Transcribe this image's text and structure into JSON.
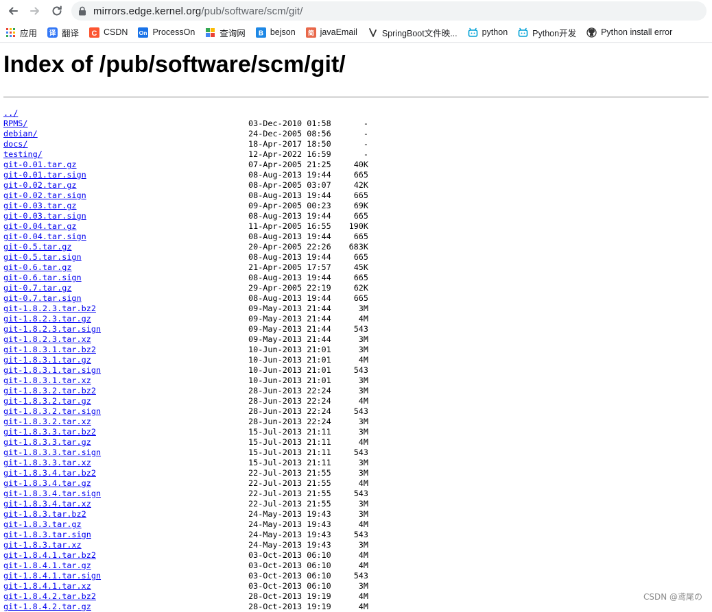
{
  "browser": {
    "url_host": "mirrors.edge.kernel.org",
    "url_path": "/pub/software/scm/git/",
    "bookmarks": [
      {
        "label": "应用",
        "icon": "apps-grid-icon",
        "color": "#ea4335"
      },
      {
        "label": "翻译",
        "icon": "translate-icon",
        "color": "#3478f6"
      },
      {
        "label": "CSDN",
        "icon": "csdn-icon",
        "color": "#fc5531"
      },
      {
        "label": "ProcessOn",
        "icon": "processon-icon",
        "color": "#1a73e8"
      },
      {
        "label": "查询网",
        "icon": "query-site-icon",
        "color": "#34a853"
      },
      {
        "label": "bejson",
        "icon": "bejson-icon",
        "color": "#1e88e5"
      },
      {
        "label": "javaEmail",
        "icon": "javaemail-icon",
        "color": "#e8684a"
      },
      {
        "label": "SpringBoot文件映...",
        "icon": "springboot-icon",
        "color": "#333333"
      },
      {
        "label": "python",
        "icon": "python-bot-icon",
        "color": "#00a1d6"
      },
      {
        "label": "Python开发",
        "icon": "python-dev-bot-icon",
        "color": "#00a1d6"
      },
      {
        "label": "Python install error",
        "icon": "github-icon",
        "color": "#333333"
      }
    ]
  },
  "page": {
    "title": "Index of /pub/software/scm/git/",
    "entries": [
      {
        "name": "../",
        "date": "",
        "size": ""
      },
      {
        "name": "RPMS/",
        "date": "03-Dec-2010 01:58",
        "size": "-"
      },
      {
        "name": "debian/",
        "date": "24-Dec-2005 08:56",
        "size": "-"
      },
      {
        "name": "docs/",
        "date": "18-Apr-2017 18:50",
        "size": "-"
      },
      {
        "name": "testing/",
        "date": "12-Apr-2022 16:59",
        "size": "-"
      },
      {
        "name": "git-0.01.tar.gz",
        "date": "07-Apr-2005 21:25",
        "size": "40K"
      },
      {
        "name": "git-0.01.tar.sign",
        "date": "08-Aug-2013 19:44",
        "size": "665"
      },
      {
        "name": "git-0.02.tar.gz",
        "date": "08-Apr-2005 03:07",
        "size": "42K"
      },
      {
        "name": "git-0.02.tar.sign",
        "date": "08-Aug-2013 19:44",
        "size": "665"
      },
      {
        "name": "git-0.03.tar.gz",
        "date": "09-Apr-2005 00:23",
        "size": "69K"
      },
      {
        "name": "git-0.03.tar.sign",
        "date": "08-Aug-2013 19:44",
        "size": "665"
      },
      {
        "name": "git-0.04.tar.gz",
        "date": "11-Apr-2005 16:55",
        "size": "190K"
      },
      {
        "name": "git-0.04.tar.sign",
        "date": "08-Aug-2013 19:44",
        "size": "665"
      },
      {
        "name": "git-0.5.tar.gz",
        "date": "20-Apr-2005 22:26",
        "size": "683K"
      },
      {
        "name": "git-0.5.tar.sign",
        "date": "08-Aug-2013 19:44",
        "size": "665"
      },
      {
        "name": "git-0.6.tar.gz",
        "date": "21-Apr-2005 17:57",
        "size": "45K"
      },
      {
        "name": "git-0.6.tar.sign",
        "date": "08-Aug-2013 19:44",
        "size": "665"
      },
      {
        "name": "git-0.7.tar.gz",
        "date": "29-Apr-2005 22:19",
        "size": "62K"
      },
      {
        "name": "git-0.7.tar.sign",
        "date": "08-Aug-2013 19:44",
        "size": "665"
      },
      {
        "name": "git-1.8.2.3.tar.bz2",
        "date": "09-May-2013 21:44",
        "size": "3M"
      },
      {
        "name": "git-1.8.2.3.tar.gz",
        "date": "09-May-2013 21:44",
        "size": "4M"
      },
      {
        "name": "git-1.8.2.3.tar.sign",
        "date": "09-May-2013 21:44",
        "size": "543"
      },
      {
        "name": "git-1.8.2.3.tar.xz",
        "date": "09-May-2013 21:44",
        "size": "3M"
      },
      {
        "name": "git-1.8.3.1.tar.bz2",
        "date": "10-Jun-2013 21:01",
        "size": "3M"
      },
      {
        "name": "git-1.8.3.1.tar.gz",
        "date": "10-Jun-2013 21:01",
        "size": "4M"
      },
      {
        "name": "git-1.8.3.1.tar.sign",
        "date": "10-Jun-2013 21:01",
        "size": "543"
      },
      {
        "name": "git-1.8.3.1.tar.xz",
        "date": "10-Jun-2013 21:01",
        "size": "3M"
      },
      {
        "name": "git-1.8.3.2.tar.bz2",
        "date": "28-Jun-2013 22:24",
        "size": "3M"
      },
      {
        "name": "git-1.8.3.2.tar.gz",
        "date": "28-Jun-2013 22:24",
        "size": "4M"
      },
      {
        "name": "git-1.8.3.2.tar.sign",
        "date": "28-Jun-2013 22:24",
        "size": "543"
      },
      {
        "name": "git-1.8.3.2.tar.xz",
        "date": "28-Jun-2013 22:24",
        "size": "3M"
      },
      {
        "name": "git-1.8.3.3.tar.bz2",
        "date": "15-Jul-2013 21:11",
        "size": "3M"
      },
      {
        "name": "git-1.8.3.3.tar.gz",
        "date": "15-Jul-2013 21:11",
        "size": "4M"
      },
      {
        "name": "git-1.8.3.3.tar.sign",
        "date": "15-Jul-2013 21:11",
        "size": "543"
      },
      {
        "name": "git-1.8.3.3.tar.xz",
        "date": "15-Jul-2013 21:11",
        "size": "3M"
      },
      {
        "name": "git-1.8.3.4.tar.bz2",
        "date": "22-Jul-2013 21:55",
        "size": "3M"
      },
      {
        "name": "git-1.8.3.4.tar.gz",
        "date": "22-Jul-2013 21:55",
        "size": "4M"
      },
      {
        "name": "git-1.8.3.4.tar.sign",
        "date": "22-Jul-2013 21:55",
        "size": "543"
      },
      {
        "name": "git-1.8.3.4.tar.xz",
        "date": "22-Jul-2013 21:55",
        "size": "3M"
      },
      {
        "name": "git-1.8.3.tar.bz2",
        "date": "24-May-2013 19:43",
        "size": "3M"
      },
      {
        "name": "git-1.8.3.tar.gz",
        "date": "24-May-2013 19:43",
        "size": "4M"
      },
      {
        "name": "git-1.8.3.tar.sign",
        "date": "24-May-2013 19:43",
        "size": "543"
      },
      {
        "name": "git-1.8.3.tar.xz",
        "date": "24-May-2013 19:43",
        "size": "3M"
      },
      {
        "name": "git-1.8.4.1.tar.bz2",
        "date": "03-Oct-2013 06:10",
        "size": "4M"
      },
      {
        "name": "git-1.8.4.1.tar.gz",
        "date": "03-Oct-2013 06:10",
        "size": "4M"
      },
      {
        "name": "git-1.8.4.1.tar.sign",
        "date": "03-Oct-2013 06:10",
        "size": "543"
      },
      {
        "name": "git-1.8.4.1.tar.xz",
        "date": "03-Oct-2013 06:10",
        "size": "3M"
      },
      {
        "name": "git-1.8.4.2.tar.bz2",
        "date": "28-Oct-2013 19:19",
        "size": "4M"
      },
      {
        "name": "git-1.8.4.2.tar.gz",
        "date": "28-Oct-2013 19:19",
        "size": "4M"
      }
    ]
  },
  "watermark": "CSDN @鸢尾の"
}
